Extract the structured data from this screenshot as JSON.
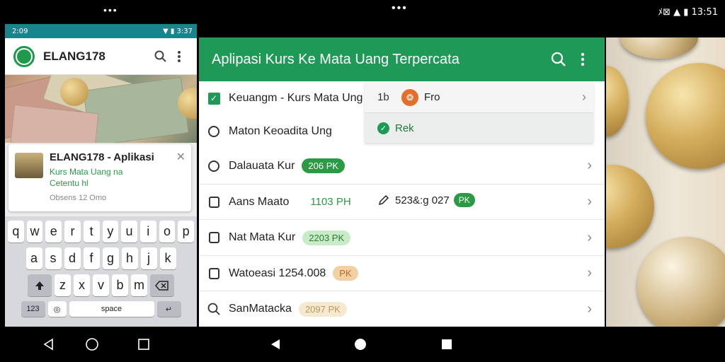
{
  "status_bar": {
    "left_dots": "•••",
    "center_dots": "•••",
    "right_text": "ﾒ⊠ ▲ ▮ 13:51"
  },
  "phone": {
    "status_time": "2:09",
    "status_right": "▼ ▮ 3:37",
    "app_title": "ELANG178",
    "notification": {
      "title": "ELANG178 - Aplikasi",
      "line1": "Kurs Mata Uang na",
      "line2": "Cetentu hl",
      "time": "Obsens 12 Omo"
    },
    "keyboard": {
      "row1": [
        "q",
        "w",
        "e",
        "r",
        "t",
        "y",
        "u",
        "i",
        "o",
        "p"
      ],
      "row2": [
        "a",
        "s",
        "d",
        "f",
        "g",
        "h",
        "j",
        "k"
      ],
      "row3": [
        "z",
        "x",
        "v",
        "b",
        "m"
      ],
      "row4_left": "123",
      "row4_space": "space"
    }
  },
  "app": {
    "title": "Aplipasi Kurs Ke Mata Uang Terpercata",
    "rows": [
      {
        "label": "Keuangm - Kurs Mata Ung"
      },
      {
        "label": "Maton Keoadita Ung"
      },
      {
        "label": "Dalauata Kur",
        "pill": "206 PK"
      },
      {
        "label": "Aans Maato",
        "pill": "1103 PH",
        "secondary": "523&:g 027",
        "secondary_tag": "PK"
      },
      {
        "label": "Nat Mata Kur",
        "pill": "2203 PK"
      },
      {
        "label": "Watoeasi 1254.008",
        "pill": "PK"
      },
      {
        "label": "SanMatacka",
        "pill": "2097 PK"
      }
    ],
    "dropdown": {
      "number": "1b",
      "currency": "Fro",
      "currency_icon": "❂",
      "selected": "Rek"
    }
  },
  "colors": {
    "accent": "#1f9a56",
    "phone_status": "#17868c",
    "pill_green": "#2a9a45"
  }
}
